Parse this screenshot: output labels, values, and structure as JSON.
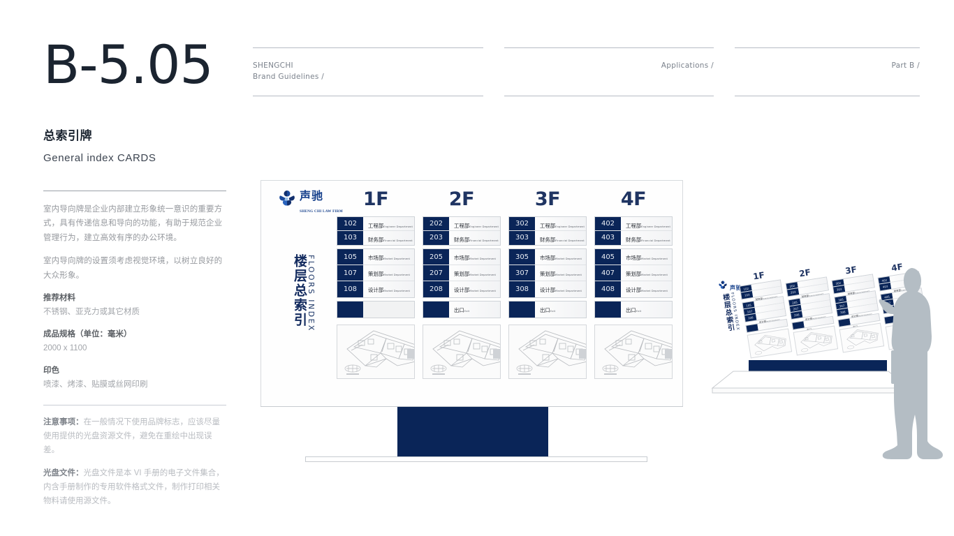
{
  "sidebar": {
    "page_code": "B-5.05",
    "title_cn": "总索引牌",
    "title_en": "General index CARDS",
    "paragraphs": [
      "室内导向牌是企业内部建立形象统一意识的重要方式，具有传递信息和导向的功能，有助于规范企业管理行为，建立高效有序的办公环境。",
      "室内导向牌的设置须考虑视觉环境，以树立良好的大众形象。"
    ],
    "fields": [
      {
        "label": "推荐材料",
        "value": "不锈钢、亚克力或其它材质"
      },
      {
        "label": "成品规格（单位：毫米）",
        "value": "2000 x 1100"
      },
      {
        "label": "印色",
        "value": "喷漆、烤漆、贴膜或丝网印刷"
      }
    ],
    "notes": [
      {
        "label": "注意事项：",
        "text": "在一般情况下使用品牌标志，应该尽量使用提供的光盘资源文件，避免在重绘中出现误差。"
      },
      {
        "label": "光盘文件：",
        "text": "光盘文件是本 VI 手册的电子文件集合，内含手册制作的专用软件格式文件，制作打印相关物料请使用源文件。"
      }
    ]
  },
  "header": {
    "brand_line1": "SHENGCHI",
    "brand_line2": "Brand Guidelines /",
    "section": "Applications /",
    "part": "Part B /"
  },
  "sign": {
    "logo_cn": "声驰",
    "logo_en": "SHENG CHI LAW FIRM",
    "vertical_cn": "楼层总索引",
    "vertical_en": "FLOORS INDEX",
    "floors": [
      {
        "label": "1F",
        "group_a": [
          {
            "num": "102",
            "cn": "工程部",
            "en": "Engineer Department"
          },
          {
            "num": "103",
            "cn": "财务部",
            "en": "Financial Department"
          }
        ],
        "group_b": [
          {
            "num": "105",
            "cn": "市场部",
            "en": "Market Department"
          },
          {
            "num": "107",
            "cn": "策划部",
            "en": "Market Department"
          },
          {
            "num": "108",
            "cn": "设计部",
            "en": "Market Department"
          }
        ],
        "exit": {
          "num": "",
          "cn": "",
          "en": ""
        }
      },
      {
        "label": "2F",
        "group_a": [
          {
            "num": "202",
            "cn": "工程部",
            "en": "Engineer Department"
          },
          {
            "num": "203",
            "cn": "财务部",
            "en": "Financial Department"
          }
        ],
        "group_b": [
          {
            "num": "205",
            "cn": "市场部",
            "en": "Market Department"
          },
          {
            "num": "207",
            "cn": "策划部",
            "en": "Market Department"
          },
          {
            "num": "208",
            "cn": "设计部",
            "en": "Market Department"
          }
        ],
        "exit": {
          "num": "",
          "cn": "出口",
          "en": "Exit"
        }
      },
      {
        "label": "3F",
        "group_a": [
          {
            "num": "302",
            "cn": "工程部",
            "en": "Engineer Department"
          },
          {
            "num": "303",
            "cn": "财务部",
            "en": "Financial Department"
          }
        ],
        "group_b": [
          {
            "num": "305",
            "cn": "市场部",
            "en": "Market Department"
          },
          {
            "num": "307",
            "cn": "策划部",
            "en": "Market Department"
          },
          {
            "num": "308",
            "cn": "设计部",
            "en": "Market Department"
          }
        ],
        "exit": {
          "num": "",
          "cn": "出口",
          "en": "Exit"
        }
      },
      {
        "label": "4F",
        "group_a": [
          {
            "num": "402",
            "cn": "工程部",
            "en": "Engineer Department"
          },
          {
            "num": "403",
            "cn": "财务部",
            "en": "Financial Department"
          }
        ],
        "group_b": [
          {
            "num": "405",
            "cn": "市场部",
            "en": "Market Department"
          },
          {
            "num": "407",
            "cn": "策划部",
            "en": "Market Department"
          },
          {
            "num": "408",
            "cn": "设计部",
            "en": "Market Department"
          }
        ],
        "exit": {
          "num": "",
          "cn": "出口",
          "en": "Exit"
        }
      }
    ]
  },
  "colors": {
    "navy": "#0A2558",
    "logo_blue": "#17418C",
    "heading_navy": "#1F3462",
    "text_gray": "#96999E"
  }
}
